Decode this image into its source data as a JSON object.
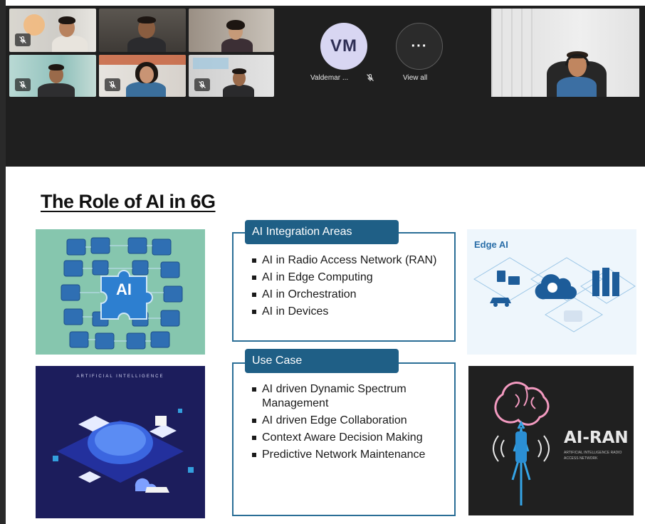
{
  "meeting": {
    "participant_tiles": [
      {
        "id": "p1",
        "muted": true
      },
      {
        "id": "p2",
        "muted": false
      },
      {
        "id": "p3",
        "muted": false,
        "active": true
      },
      {
        "id": "p4",
        "muted": true
      },
      {
        "id": "p5",
        "muted": true
      },
      {
        "id": "p6",
        "muted": true
      }
    ],
    "avatar": {
      "initials": "VM",
      "name": "Valdemar ...",
      "muted": true
    },
    "view_all": {
      "glyph": "···",
      "label": "View all"
    },
    "colors": {
      "bar_bg": "#1f1f1f",
      "active_outline": "#7b80d8",
      "avatar_bg": "#d8d6f2"
    }
  },
  "slide": {
    "title": "The Role of AI in 6G",
    "integration_box": {
      "heading": "AI Integration Areas",
      "items": [
        "AI in Radio Access Network (RAN)",
        "AI in Edge Computing",
        "AI in Orchestration",
        "AI in Devices"
      ]
    },
    "use_case_box": {
      "heading": "Use Case",
      "items": [
        "AI driven Dynamic Spectrum Management",
        "AI driven Edge Collaboration",
        "Context Aware Decision Making",
        "Predictive Network Maintenance"
      ]
    },
    "images": {
      "ai_puzzle": {
        "label": "AI"
      },
      "edge_ai": {
        "label": "Edge AI"
      },
      "artificial_intelligence": {
        "caption": "ARTIFICIAL INTELLIGENCE"
      },
      "ai_ran": {
        "label": "AI-RAN",
        "subtitle": "ARTIFICIAL INTELLIGENCE RADIO ACCESS NETWORK"
      }
    },
    "colors": {
      "accent": "#1f5f86",
      "border": "#2a6e96",
      "edge_title": "#2a6ea8"
    }
  }
}
